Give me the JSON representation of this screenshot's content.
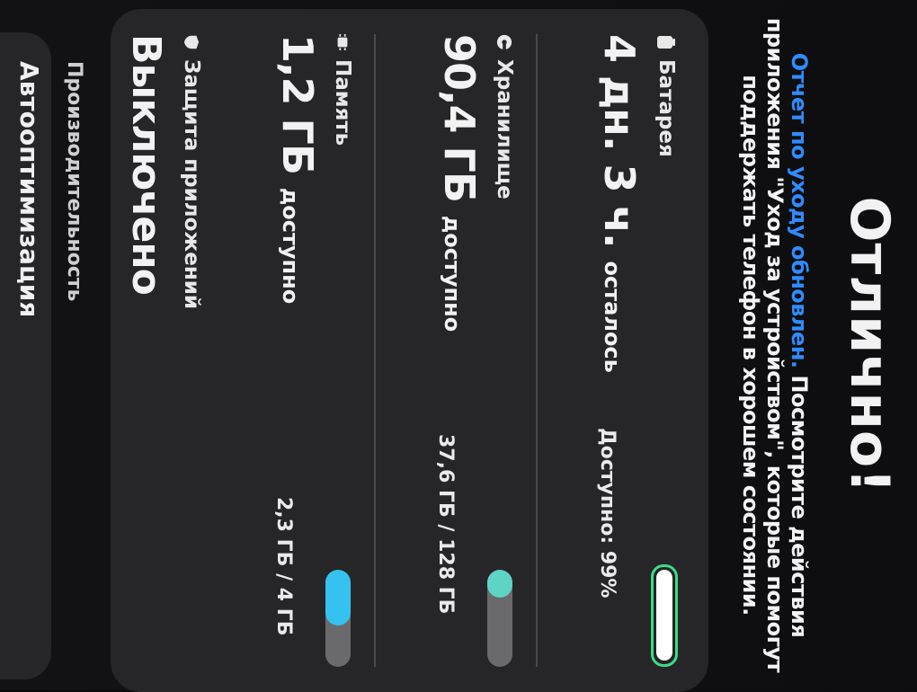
{
  "header": {
    "title": "Отлично!",
    "subtitle_link": "Отчет по уходу обновлен.",
    "subtitle_text": " Посмотрите действия приложения \"Уход за устройством\", которые помогут поддержать телефон в хорошем состоянии."
  },
  "battery": {
    "label": "Батарея",
    "main_value": "4 дн. 3 ч.",
    "main_unit": "осталось",
    "right_text": "Доступно: 99%",
    "level_percent": 99,
    "color": "#3ddc84"
  },
  "storage": {
    "label": "Хранилище",
    "main_value": "90,4 ГБ",
    "main_unit": "доступно",
    "right_text": "37,6 ГБ / 128 ГБ",
    "used_fraction": 0.29,
    "color": "#5fd3c6"
  },
  "memory": {
    "label": "Память",
    "main_value": "1,2 ГБ",
    "main_unit": "доступно",
    "right_text": "2,3 ГБ / 4 ГБ",
    "used_fraction": 0.575,
    "color": "#35c2f0"
  },
  "app_protection": {
    "label": "Защита приложений",
    "status": "Выключено"
  },
  "performance": {
    "section_label": "Производительность",
    "item_label": "Автооптимизация"
  },
  "icons": {
    "battery": "battery-icon",
    "storage": "storage-icon",
    "memory": "memory-chip-icon",
    "protection": "shield-icon"
  }
}
